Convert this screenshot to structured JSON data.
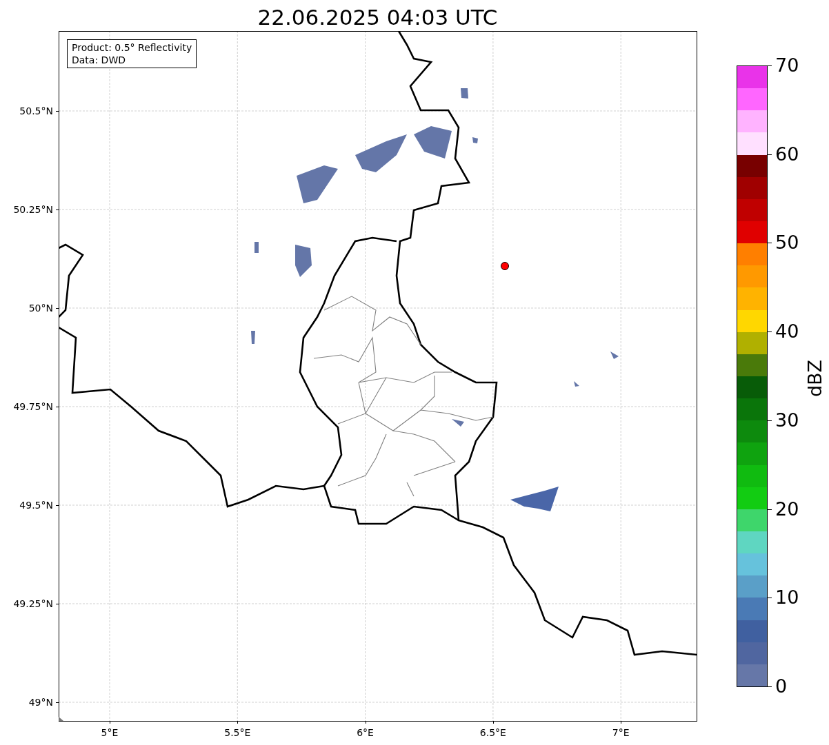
{
  "title": "22.06.2025 04:03 UTC",
  "info_box": [
    "Product: 0.5° Reflectivity",
    "Data: DWD"
  ],
  "map": {
    "lat_ticks": [
      "50.5°N",
      "50.25°N",
      "50°N",
      "49.75°N",
      "49.5°N",
      "49.25°N",
      "49°N"
    ],
    "lon_ticks": [
      "5°E",
      "5.5°E",
      "6°E",
      "6.5°E",
      "7°E"
    ],
    "marker": {
      "color": "#ff0000"
    }
  },
  "colorbar": {
    "label": "dBZ",
    "ticks": [
      "70",
      "60",
      "50",
      "40",
      "30",
      "20",
      "10",
      "0"
    ],
    "segments": [
      {
        "color": "#e933e9"
      },
      {
        "color": "#ff66ff"
      },
      {
        "color": "#ffb3ff"
      },
      {
        "color": "#ffe0ff"
      },
      {
        "color": "#780000"
      },
      {
        "color": "#a00000"
      },
      {
        "color": "#c00000"
      },
      {
        "color": "#e00000"
      },
      {
        "color": "#ff7f00"
      },
      {
        "color": "#ff9900"
      },
      {
        "color": "#ffb300"
      },
      {
        "color": "#ffd700"
      },
      {
        "color": "#b0b000"
      },
      {
        "color": "#4a7a0a"
      },
      {
        "color": "#085c08"
      },
      {
        "color": "#0a750a"
      },
      {
        "color": "#0d8a0d"
      },
      {
        "color": "#0fa30f"
      },
      {
        "color": "#10bb10"
      },
      {
        "color": "#12cc12"
      },
      {
        "color": "#3ed66b"
      },
      {
        "color": "#5fd6c1"
      },
      {
        "color": "#66c2dc"
      },
      {
        "color": "#5a9fc8"
      },
      {
        "color": "#4a7ab5"
      },
      {
        "color": "#4060a0"
      },
      {
        "color": "#5066a0"
      },
      {
        "color": "#6677a8"
      }
    ]
  }
}
